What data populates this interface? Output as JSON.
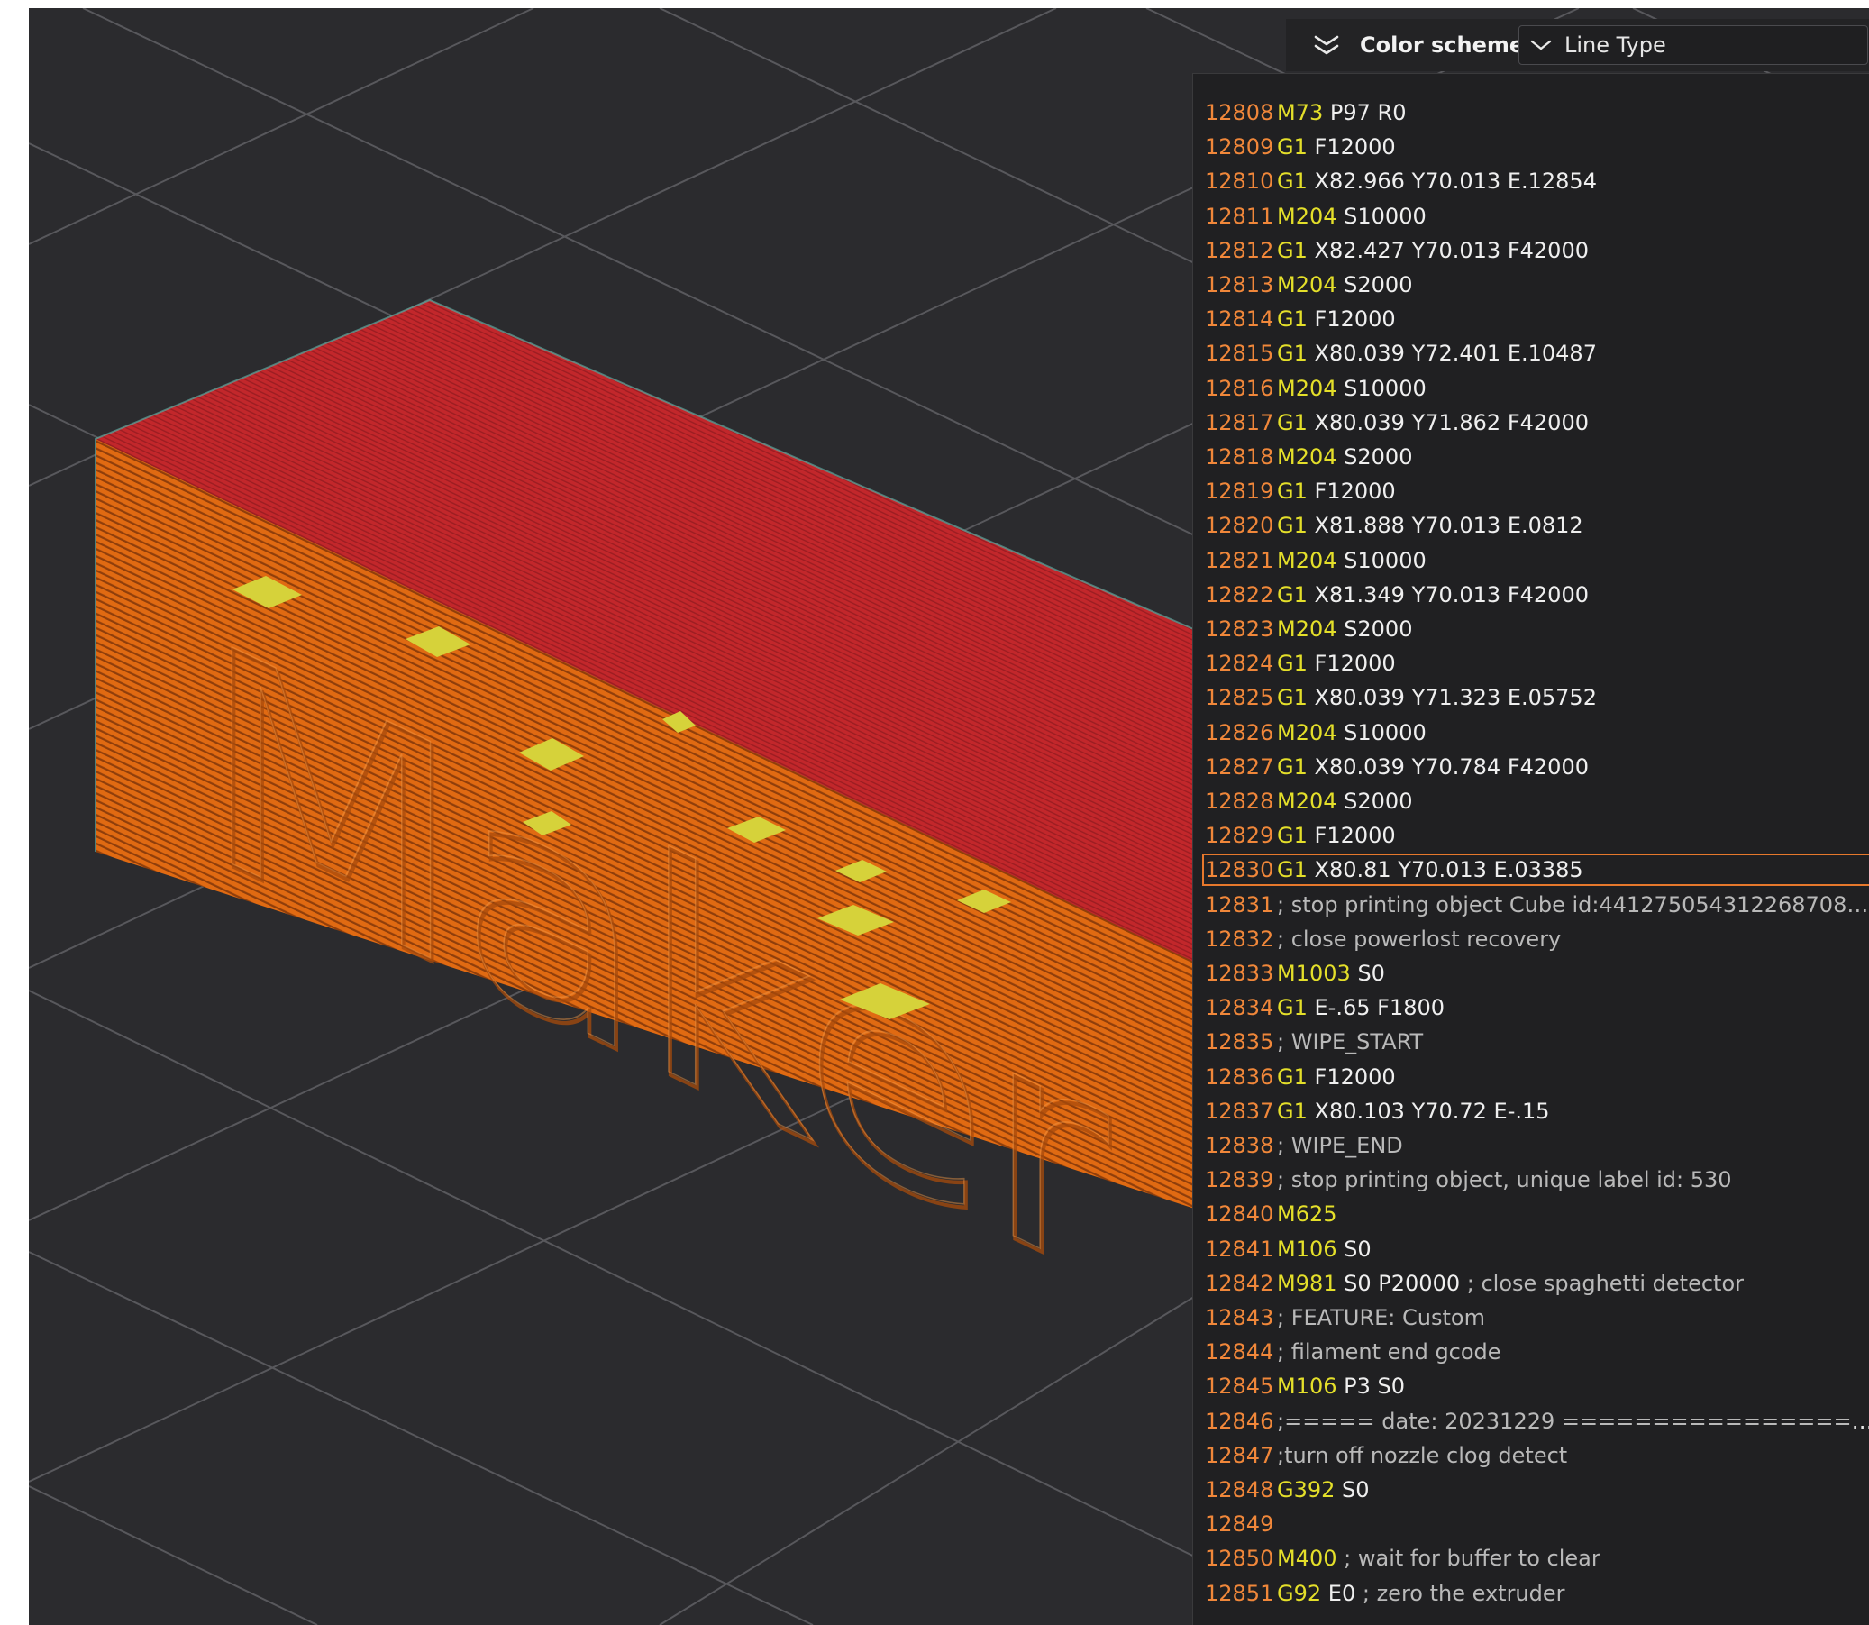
{
  "colors": {
    "viewport_bg": "#2b2b2e",
    "top_face": "#c2272b",
    "front_face": "#e06a12",
    "right_face": "#cf5f0e",
    "line_number": "#f0873a",
    "command": "#e4df2a",
    "arguments": "#efefef",
    "comment": "#b9b9b9",
    "current_line_border": "#e6782c"
  },
  "toolbar": {
    "collapse_icon": "double-chevron-down-icon",
    "title": "Color scheme",
    "select_icon": "chevron-down-icon",
    "select_value": "Line Type"
  },
  "model": {
    "embossed_text": "Maker"
  },
  "gcode": {
    "current_line": "12830",
    "lines": [
      {
        "num": "12808",
        "cmd": "M73",
        "args": "P97 R0",
        "comment": ""
      },
      {
        "num": "12809",
        "cmd": "G1",
        "args": "F12000",
        "comment": ""
      },
      {
        "num": "12810",
        "cmd": "G1",
        "args": "X82.966 Y70.013 E.12854",
        "comment": ""
      },
      {
        "num": "12811",
        "cmd": "M204",
        "args": "S10000",
        "comment": ""
      },
      {
        "num": "12812",
        "cmd": "G1",
        "args": "X82.427 Y70.013 F42000",
        "comment": ""
      },
      {
        "num": "12813",
        "cmd": "M204",
        "args": "S2000",
        "comment": ""
      },
      {
        "num": "12814",
        "cmd": "G1",
        "args": "F12000",
        "comment": ""
      },
      {
        "num": "12815",
        "cmd": "G1",
        "args": "X80.039 Y72.401 E.10487",
        "comment": ""
      },
      {
        "num": "12816",
        "cmd": "M204",
        "args": "S10000",
        "comment": ""
      },
      {
        "num": "12817",
        "cmd": "G1",
        "args": "X80.039 Y71.862 F42000",
        "comment": ""
      },
      {
        "num": "12818",
        "cmd": "M204",
        "args": "S2000",
        "comment": ""
      },
      {
        "num": "12819",
        "cmd": "G1",
        "args": "F12000",
        "comment": ""
      },
      {
        "num": "12820",
        "cmd": "G1",
        "args": "X81.888 Y70.013 E.0812",
        "comment": ""
      },
      {
        "num": "12821",
        "cmd": "M204",
        "args": "S10000",
        "comment": ""
      },
      {
        "num": "12822",
        "cmd": "G1",
        "args": "X81.349 Y70.013 F42000",
        "comment": ""
      },
      {
        "num": "12823",
        "cmd": "M204",
        "args": "S2000",
        "comment": ""
      },
      {
        "num": "12824",
        "cmd": "G1",
        "args": "F12000",
        "comment": ""
      },
      {
        "num": "12825",
        "cmd": "G1",
        "args": "X80.039 Y71.323 E.05752",
        "comment": ""
      },
      {
        "num": "12826",
        "cmd": "M204",
        "args": "S10000",
        "comment": ""
      },
      {
        "num": "12827",
        "cmd": "G1",
        "args": "X80.039 Y70.784 F42000",
        "comment": ""
      },
      {
        "num": "12828",
        "cmd": "M204",
        "args": "S2000",
        "comment": ""
      },
      {
        "num": "12829",
        "cmd": "G1",
        "args": "F12000",
        "comment": ""
      },
      {
        "num": "12830",
        "cmd": "G1",
        "args": "X80.81 Y70.013 E.03385",
        "comment": ""
      },
      {
        "num": "12831",
        "cmd": "",
        "args": "",
        "comment": "; stop printing object Cube id:441275054312268708…"
      },
      {
        "num": "12832",
        "cmd": "",
        "args": "",
        "comment": "; close powerlost recovery"
      },
      {
        "num": "12833",
        "cmd": "M1003",
        "args": "S0",
        "comment": ""
      },
      {
        "num": "12834",
        "cmd": "G1",
        "args": "E-.65 F1800",
        "comment": ""
      },
      {
        "num": "12835",
        "cmd": "",
        "args": "",
        "comment": "; WIPE_START"
      },
      {
        "num": "12836",
        "cmd": "G1",
        "args": "F12000",
        "comment": ""
      },
      {
        "num": "12837",
        "cmd": "G1",
        "args": "X80.103 Y70.72 E-.15",
        "comment": ""
      },
      {
        "num": "12838",
        "cmd": "",
        "args": "",
        "comment": "; WIPE_END"
      },
      {
        "num": "12839",
        "cmd": "",
        "args": "",
        "comment": "; stop printing object, unique label id: 530"
      },
      {
        "num": "12840",
        "cmd": "M625",
        "args": "",
        "comment": ""
      },
      {
        "num": "12841",
        "cmd": "M106",
        "args": "S0",
        "comment": ""
      },
      {
        "num": "12842",
        "cmd": "M981",
        "args": "S0 P20000",
        "comment": "; close spaghetti detector"
      },
      {
        "num": "12843",
        "cmd": "",
        "args": "",
        "comment": "; FEATURE: Custom"
      },
      {
        "num": "12844",
        "cmd": "",
        "args": "",
        "comment": "; filament end gcode"
      },
      {
        "num": "12845",
        "cmd": "M106",
        "args": "P3 S0",
        "comment": ""
      },
      {
        "num": "12846",
        "cmd": "",
        "args": "",
        "comment": ";===== date: 20231229 ====================="
      },
      {
        "num": "12847",
        "cmd": "",
        "args": "",
        "comment": ";turn off nozzle clog detect"
      },
      {
        "num": "12848",
        "cmd": "G392",
        "args": "S0",
        "comment": ""
      },
      {
        "num": "12849",
        "cmd": "",
        "args": "",
        "comment": ""
      },
      {
        "num": "12850",
        "cmd": "M400",
        "args": "",
        "comment": "; wait for buffer to clear"
      },
      {
        "num": "12851",
        "cmd": "G92",
        "args": "E0",
        "comment": "; zero the extruder"
      }
    ]
  }
}
